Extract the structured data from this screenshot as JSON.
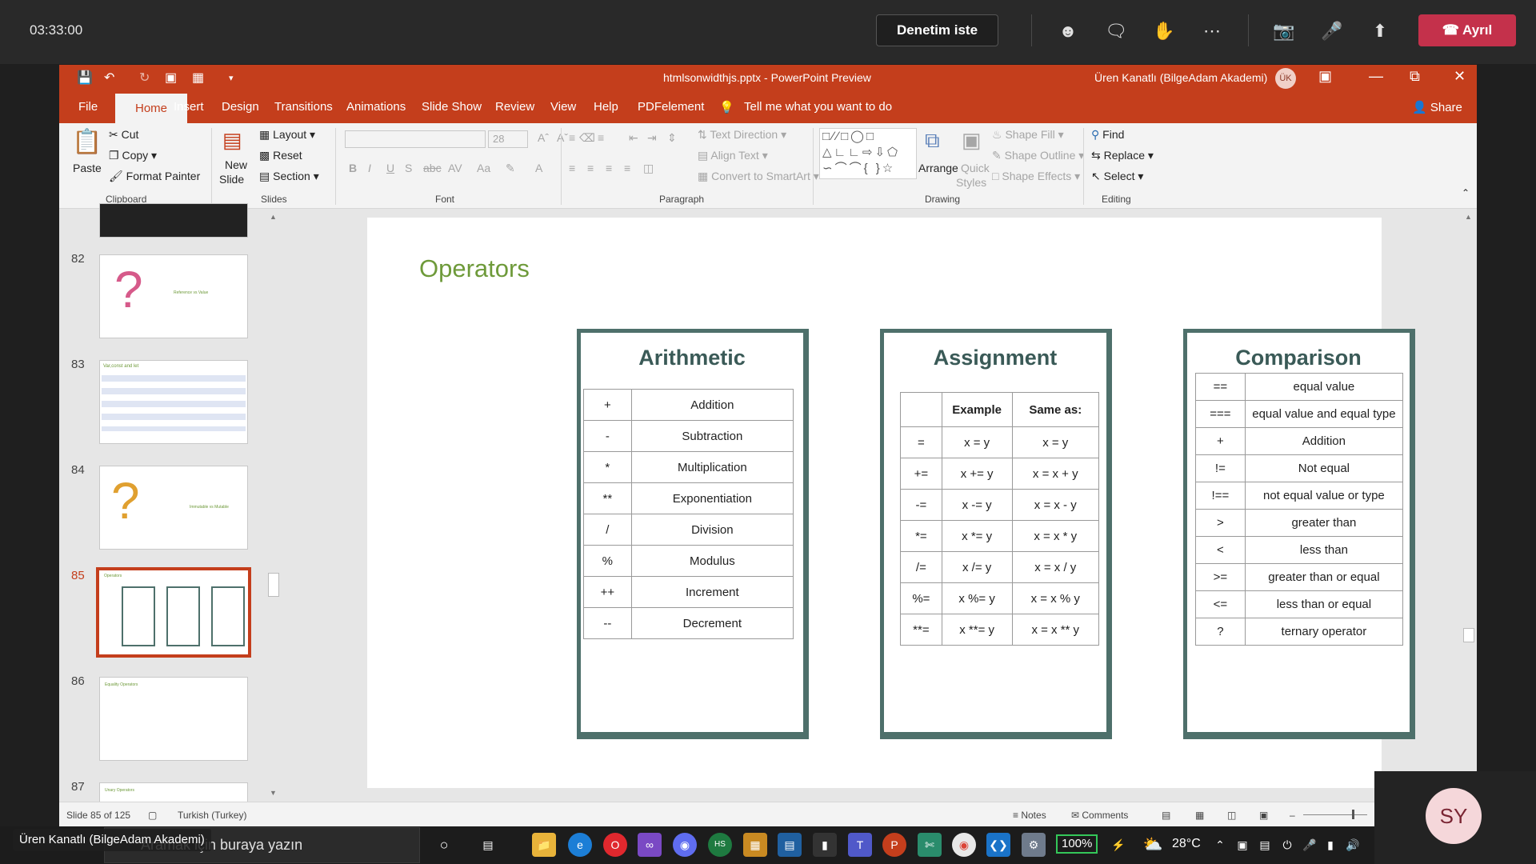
{
  "meeting": {
    "time": "03:33:00",
    "request_control": "Denetim iste",
    "leave": "Ayrıl",
    "icons": [
      "participants-icon",
      "chat-icon",
      "raise-hand-icon",
      "more-icon",
      "camera-off-icon",
      "mic-off-icon",
      "share-screen-icon"
    ]
  },
  "window": {
    "doc_title": "htmlsonwidthjs.pptx  -  PowerPoint Preview",
    "user": "Üren Kanatlı (BilgeAdam Akademi)",
    "user_initials": "ÜK",
    "share": "Share"
  },
  "tabs": [
    "File",
    "Home",
    "Insert",
    "Design",
    "Transitions",
    "Animations",
    "Slide Show",
    "Review",
    "View",
    "Help",
    "PDFelement"
  ],
  "tell_me": "Tell me what you want to do",
  "ribbon": {
    "clipboard": {
      "paste": "Paste",
      "cut": "Cut",
      "copy": "Copy",
      "format_painter": "Format Painter",
      "label": "Clipboard"
    },
    "slides": {
      "new_slide_1": "New",
      "new_slide_2": "Slide",
      "layout": "Layout",
      "reset": "Reset",
      "section": "Section",
      "label": "Slides"
    },
    "font": {
      "size": "28",
      "label": "Font"
    },
    "paragraph": {
      "text_direction": "Text Direction",
      "align_text": "Align Text",
      "smartart": "Convert to SmartArt",
      "label": "Paragraph"
    },
    "drawing": {
      "arrange": "Arrange",
      "quick_styles_1": "Quick",
      "quick_styles_2": "Styles",
      "shape_fill": "Shape Fill",
      "shape_outline": "Shape Outline",
      "shape_effects": "Shape Effects",
      "label": "Drawing"
    },
    "editing": {
      "find": "Find",
      "replace": "Replace",
      "select": "Select",
      "label": "Editing"
    }
  },
  "thumbnails": [
    {
      "num": "82",
      "caption": "Reference vs Value"
    },
    {
      "num": "83",
      "caption": "Var,const and let"
    },
    {
      "num": "84",
      "caption": "Immutable vs Mutable"
    },
    {
      "num": "85",
      "caption": "Operators"
    },
    {
      "num": "86",
      "caption": "Equality Operators"
    },
    {
      "num": "87",
      "caption": "Unary Operators"
    }
  ],
  "slide": {
    "title": "Operators",
    "arithmetic": {
      "heading": "Arithmetic",
      "rows": [
        [
          "+",
          "Addition"
        ],
        [
          "-",
          "Subtraction"
        ],
        [
          "*",
          "Multiplication"
        ],
        [
          "**",
          "Exponentiation"
        ],
        [
          "/",
          "Division"
        ],
        [
          "%",
          "Modulus"
        ],
        [
          "++",
          "Increment"
        ],
        [
          "--",
          "Decrement"
        ]
      ]
    },
    "assignment": {
      "heading": "Assignment",
      "headers": [
        "",
        "Example",
        "Same as:"
      ],
      "rows": [
        [
          "=",
          "x = y",
          "x = y"
        ],
        [
          "+=",
          "x += y",
          "x = x + y"
        ],
        [
          "-=",
          "x -= y",
          "x = x - y"
        ],
        [
          "*=",
          "x *= y",
          "x = x * y"
        ],
        [
          "/=",
          "x /= y",
          "x = x / y"
        ],
        [
          "%=",
          "x %= y",
          "x = x % y"
        ],
        [
          "**=",
          "x **= y",
          "x = x ** y"
        ]
      ]
    },
    "comparison": {
      "heading": "Comparison",
      "rows": [
        [
          "==",
          "equal value"
        ],
        [
          "===",
          "equal value and equal type"
        ],
        [
          "+",
          "Addition"
        ],
        [
          "!=",
          "Not equal"
        ],
        [
          "!==",
          "not equal value or type"
        ],
        [
          ">",
          "greater than"
        ],
        [
          "<",
          "less than"
        ],
        [
          ">=",
          "greater than or equal"
        ],
        [
          "<=",
          "less than or equal"
        ],
        [
          "?",
          "ternary operator"
        ]
      ]
    }
  },
  "status": {
    "slide_count": "Slide 85 of 125",
    "language": "Turkish (Turkey)",
    "notes": "Notes",
    "comments": "Comments"
  },
  "taskbar": {
    "search": "Aramak için buraya yazın",
    "battery": "100%",
    "temp": "28°C",
    "presenter_name": "Üren Kanatlı (BilgeAdam Akademi)",
    "self_initials": "SY"
  },
  "colors": {
    "ppt_accent": "#c43e1c",
    "slide_title": "#6e9a3a",
    "card_border": "#4e706b",
    "leave_red": "#c4314b"
  }
}
